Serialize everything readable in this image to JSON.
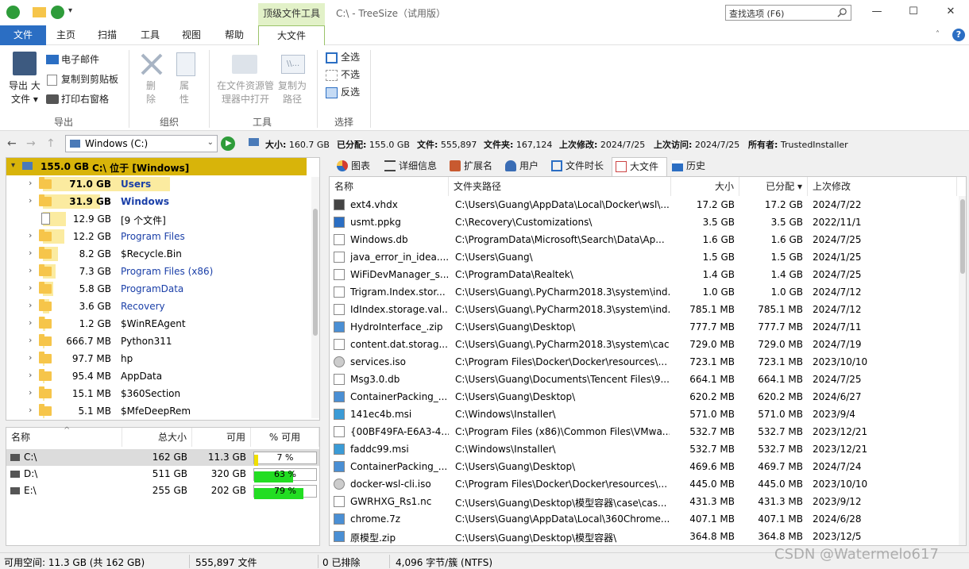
{
  "window": {
    "title": "C:\\ - TreeSize（试用版）",
    "context_tab": "顶级文件工具",
    "search_placeholder": "查找选项 (F6)",
    "minimize": "—",
    "maximize": "☐",
    "close": "✕"
  },
  "menu": {
    "tabs": [
      "文件",
      "主页",
      "扫描",
      "工具",
      "视图",
      "帮助",
      "大文件"
    ],
    "active": "大文件"
  },
  "ribbon": {
    "export_label": "导出",
    "export_big": "导出 大\n文件",
    "export_big_line1": "导出 大",
    "export_big_line2": "文件 ▾",
    "email": "电子邮件",
    "copy_clipboard": "复制到剪贴板",
    "print_pane": "打印右窗格",
    "organize_label": "组织",
    "delete_l1": "删",
    "delete_l2": "除",
    "props_l1": "属",
    "props_l2": "性",
    "tools_label": "工具",
    "open_explorer_l1": "在文件资源管",
    "open_explorer_l2": "理器中打开",
    "copy_path_l1": "复制为",
    "copy_path_l2": "路径",
    "select_label": "选择",
    "select_all": "全选",
    "select_none": "不选",
    "select_invert": "反选"
  },
  "address": {
    "drive": "Windows (C:)",
    "size_label": "大小:",
    "size": "160.7 GB",
    "alloc_label": "已分配:",
    "alloc": "155.0 GB",
    "files_label": "文件:",
    "files": "555,897",
    "folders_label": "文件夹:",
    "folders": "167,124",
    "modified_label": "上次修改:",
    "modified": "2024/7/25",
    "accessed_label": "上次访问:",
    "accessed": "2024/7/25",
    "owner_label": "所有者:",
    "owner": "TrustedInstaller"
  },
  "tree": {
    "root": {
      "size": "155.0 GB",
      "label": "C:\\  位于  [Windows]"
    },
    "items": [
      {
        "size": "71.0 GB",
        "name": "Users",
        "bold": true,
        "bar": 1.0
      },
      {
        "size": "31.9 GB",
        "name": "Windows",
        "bold": true,
        "bar": 0.45
      },
      {
        "size": "12.9 GB",
        "name": "[9 个文件]",
        "file": true,
        "bar": 0.18
      },
      {
        "size": "12.2 GB",
        "name": "Program Files",
        "link": true,
        "bar": 0.17
      },
      {
        "size": "8.2 GB",
        "name": "$Recycle.Bin",
        "bar": 0.12
      },
      {
        "size": "7.3 GB",
        "name": "Program Files (x86)",
        "link": true,
        "bar": 0.1
      },
      {
        "size": "5.8 GB",
        "name": "ProgramData",
        "link": true,
        "bar": 0.08
      },
      {
        "size": "3.6 GB",
        "name": "Recovery",
        "link": true,
        "bar": 0.05
      },
      {
        "size": "1.2 GB",
        "name": "$WinREAgent",
        "bar": 0.02
      },
      {
        "size": "666.7 MB",
        "name": "Python311",
        "bar": 0.01
      },
      {
        "size": "97.7 MB",
        "name": "hp",
        "bar": 0.005
      },
      {
        "size": "95.4 MB",
        "name": "AppData",
        "bar": 0.005
      },
      {
        "size": "15.1 MB",
        "name": "$360Section",
        "bar": 0.002
      },
      {
        "size": "5.1 MB",
        "name": "$MfeDeepRem",
        "bar": 0.001
      }
    ]
  },
  "drives": {
    "headers": [
      "名称",
      "总大小",
      "可用",
      "% 可用"
    ],
    "rows": [
      {
        "name": "C:\\",
        "total": "162 GB",
        "free": "11.3 GB",
        "pct": "7 %",
        "pct_value": 7,
        "color": "#f0e000"
      },
      {
        "name": "D:\\",
        "total": "511 GB",
        "free": "320 GB",
        "pct": "63 %",
        "pct_value": 63,
        "color": "#22dd22"
      },
      {
        "name": "E:\\",
        "total": "255 GB",
        "free": "202 GB",
        "pct": "79 %",
        "pct_value": 79,
        "color": "#22dd22"
      }
    ]
  },
  "right_tabs": [
    "图表",
    "详细信息",
    "扩展名",
    "用户",
    "文件时长",
    "大文件",
    "历史"
  ],
  "filelist": {
    "headers": [
      "名称",
      "文件夹路径",
      "大小",
      "已分配 ▾",
      "上次修改"
    ],
    "rows": [
      {
        "name": "ext4.vhdx",
        "path": "C:\\Users\\Guang\\AppData\\Local\\Docker\\wsl\\...",
        "size": "17.2 GB",
        "alloc": "17.2 GB",
        "date": "2024/7/22",
        "icon": "disk-icon"
      },
      {
        "name": "usmt.ppkg",
        "path": "C:\\Recovery\\Customizations\\",
        "size": "3.5 GB",
        "alloc": "3.5 GB",
        "date": "2022/11/1",
        "icon": "package-icon"
      },
      {
        "name": "Windows.db",
        "path": "C:\\ProgramData\\Microsoft\\Search\\Data\\Ap...",
        "size": "1.6 GB",
        "alloc": "1.6 GB",
        "date": "2024/7/25",
        "icon": "file-icon"
      },
      {
        "name": "java_error_in_idea....",
        "path": "C:\\Users\\Guang\\",
        "size": "1.5 GB",
        "alloc": "1.5 GB",
        "date": "2024/1/25",
        "icon": "file-icon"
      },
      {
        "name": "WiFiDevManager_s...",
        "path": "C:\\ProgramData\\Realtek\\",
        "size": "1.4 GB",
        "alloc": "1.4 GB",
        "date": "2024/7/25",
        "icon": "text-file-icon"
      },
      {
        "name": "Trigram.Index.stor...",
        "path": "C:\\Users\\Guang\\.PyCharm2018.3\\system\\ind...",
        "size": "1.0 GB",
        "alloc": "1.0 GB",
        "date": "2024/7/12",
        "icon": "file-icon"
      },
      {
        "name": "IdIndex.storage.val...",
        "path": "C:\\Users\\Guang\\.PyCharm2018.3\\system\\ind...",
        "size": "785.1 MB",
        "alloc": "785.1 MB",
        "date": "2024/7/12",
        "icon": "file-icon"
      },
      {
        "name": "HydroInterface_.zip",
        "path": "C:\\Users\\Guang\\Desktop\\",
        "size": "777.7 MB",
        "alloc": "777.7 MB",
        "date": "2024/7/11",
        "icon": "zip-icon"
      },
      {
        "name": "content.dat.storag...",
        "path": "C:\\Users\\Guang\\.PyCharm2018.3\\system\\cac...",
        "size": "729.0 MB",
        "alloc": "729.0 MB",
        "date": "2024/7/19",
        "icon": "file-icon"
      },
      {
        "name": "services.iso",
        "path": "C:\\Program Files\\Docker\\Docker\\resources\\...",
        "size": "723.1 MB",
        "alloc": "723.1 MB",
        "date": "2023/10/10",
        "icon": "disc-icon"
      },
      {
        "name": "Msg3.0.db",
        "path": "C:\\Users\\Guang\\Documents\\Tencent Files\\9...",
        "size": "664.1 MB",
        "alloc": "664.1 MB",
        "date": "2024/7/25",
        "icon": "file-icon"
      },
      {
        "name": "ContainerPacking_...",
        "path": "C:\\Users\\Guang\\Desktop\\",
        "size": "620.2 MB",
        "alloc": "620.2 MB",
        "date": "2024/6/27",
        "icon": "zip-icon"
      },
      {
        "name": "141ec4b.msi",
        "path": "C:\\Windows\\Installer\\",
        "size": "571.0 MB",
        "alloc": "571.0 MB",
        "date": "2023/9/4",
        "icon": "installer-icon"
      },
      {
        "name": "{00BF49FA-E6A3-4...",
        "path": "C:\\Program Files (x86)\\Common Files\\VMwa...",
        "size": "532.7 MB",
        "alloc": "532.7 MB",
        "date": "2023/12/21",
        "icon": "file-icon"
      },
      {
        "name": "faddc99.msi",
        "path": "C:\\Windows\\Installer\\",
        "size": "532.7 MB",
        "alloc": "532.7 MB",
        "date": "2023/12/21",
        "icon": "installer-icon"
      },
      {
        "name": "ContainerPacking_...",
        "path": "C:\\Users\\Guang\\Desktop\\",
        "size": "469.6 MB",
        "alloc": "469.7 MB",
        "date": "2024/7/24",
        "icon": "zip-icon"
      },
      {
        "name": "docker-wsl-cli.iso",
        "path": "C:\\Program Files\\Docker\\Docker\\resources\\...",
        "size": "445.0 MB",
        "alloc": "445.0 MB",
        "date": "2023/10/10",
        "icon": "disc-icon"
      },
      {
        "name": "GWRHXG_Rs1.nc",
        "path": "C:\\Users\\Guang\\Desktop\\模型容器\\case\\cas...",
        "size": "431.3 MB",
        "alloc": "431.3 MB",
        "date": "2023/9/12",
        "icon": "file-icon"
      },
      {
        "name": "chrome.7z",
        "path": "C:\\Users\\Guang\\AppData\\Local\\360Chrome...",
        "size": "407.1 MB",
        "alloc": "407.1 MB",
        "date": "2024/6/28",
        "icon": "zip-icon"
      },
      {
        "name": "原模型.zip",
        "path": "C:\\Users\\Guang\\Desktop\\模型容器\\",
        "size": "364.8 MB",
        "alloc": "364.8 MB",
        "date": "2023/12/5",
        "icon": "zip-icon"
      }
    ]
  },
  "status": {
    "free": "可用空间: 11.3 GB  (共 162 GB)",
    "files": "555,897 文件",
    "excluded": "0 已排除",
    "cluster": "4,096 字节/簇 (NTFS)"
  },
  "watermark": "CSDN @Watermelo617"
}
